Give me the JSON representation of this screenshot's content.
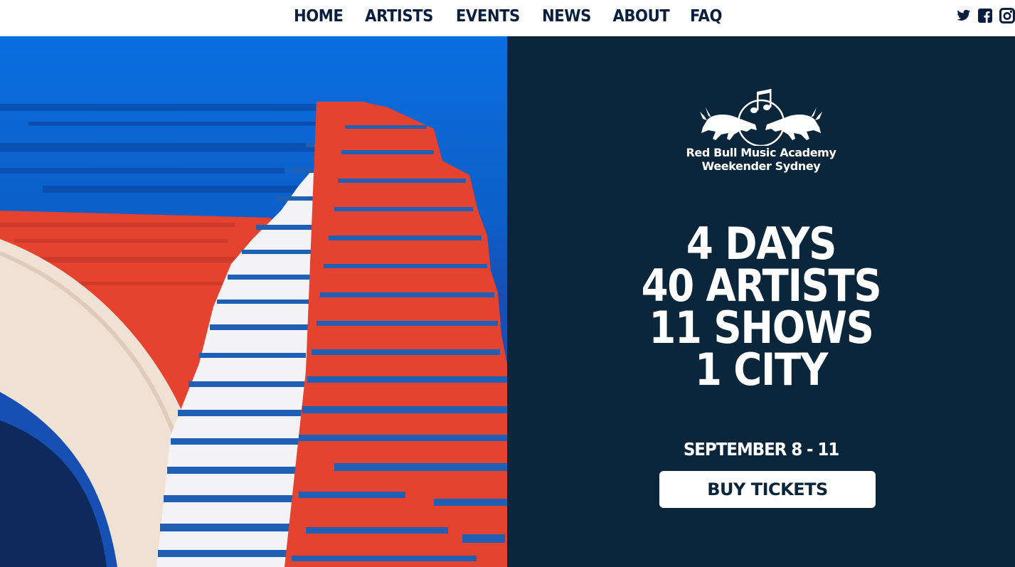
{
  "nav": {
    "items": [
      {
        "label": "HOME"
      },
      {
        "label": "ARTISTS"
      },
      {
        "label": "EVENTS"
      },
      {
        "label": "NEWS"
      },
      {
        "label": "ABOUT"
      },
      {
        "label": "FAQ"
      }
    ]
  },
  "social": {
    "icons": [
      "twitter-icon",
      "facebook-icon",
      "instagram-icon"
    ]
  },
  "logo": {
    "line1": "Red Bull Music Academy",
    "line2": "Weekender Sydney"
  },
  "stats": [
    "4 DAYS",
    "40 ARTISTS",
    "11 SHOWS",
    "1 CITY"
  ],
  "dates": "SEPTEMBER 8 - 11",
  "cta": {
    "label": "BUY TICKETS"
  },
  "colors": {
    "navy": "#0b263b",
    "nav_text": "#0a1f3d",
    "sky_blue": "#0a6fdf",
    "red": "#e5422f",
    "white": "#ffffff"
  }
}
